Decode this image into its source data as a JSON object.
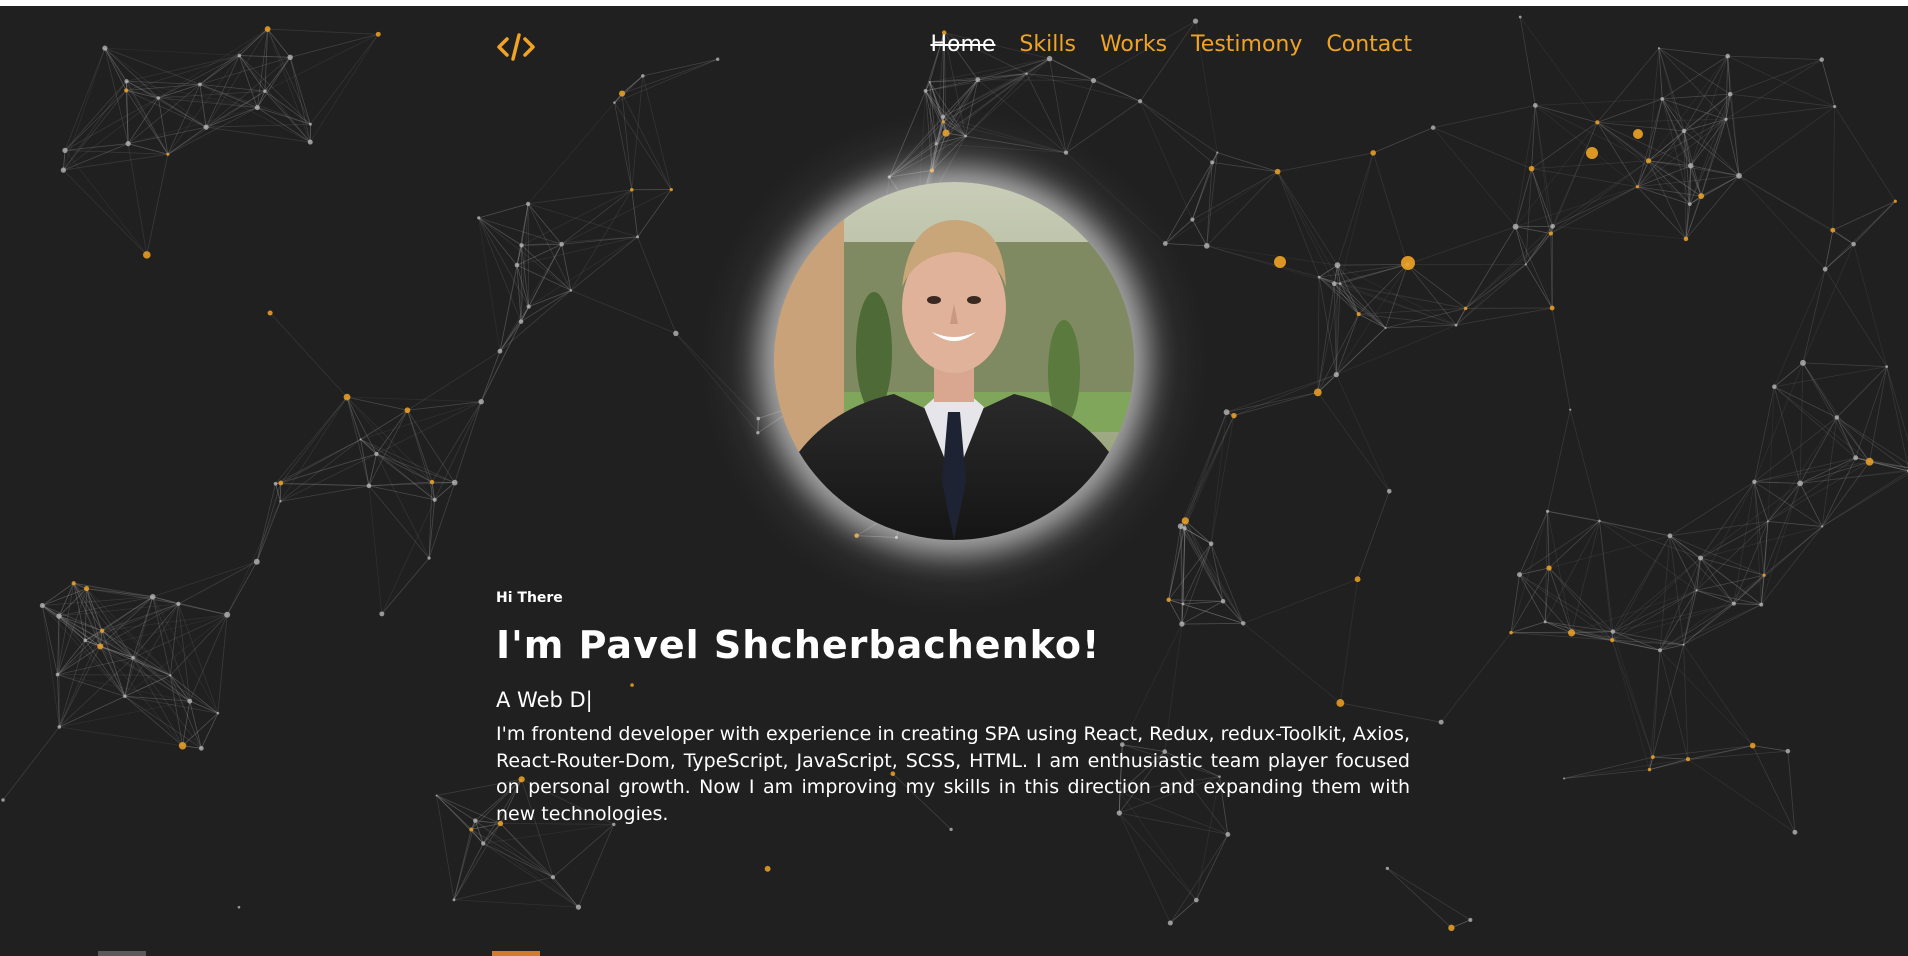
{
  "colors": {
    "background": "#202020",
    "accent": "#f0a324",
    "text": "#ffffff",
    "network_line": "#9a9a9a"
  },
  "logo": {
    "icon": "code-brackets-icon",
    "text": "</>"
  },
  "nav": {
    "items": [
      {
        "label": "Home",
        "active": true
      },
      {
        "label": "Skills",
        "active": false
      },
      {
        "label": "Works",
        "active": false
      },
      {
        "label": "Testimony",
        "active": false
      },
      {
        "label": "Contact",
        "active": false
      }
    ]
  },
  "hero": {
    "greeting": "Hi There",
    "headline": "I'm Pavel Shcherbachenko!",
    "role": "A Web D|",
    "bio": "I'm frontend developer with experience in creating SPA using React, Redux, redux-Toolkit, Axios, React-Router-Dom, TypeScript, JavaScript, SCSS, HTML. I am enthusiastic team player focused on personal growth. Now I am improving my skills in this direction and expanding them with new technologies."
  },
  "avatar": {
    "icon": "profile-photo"
  }
}
